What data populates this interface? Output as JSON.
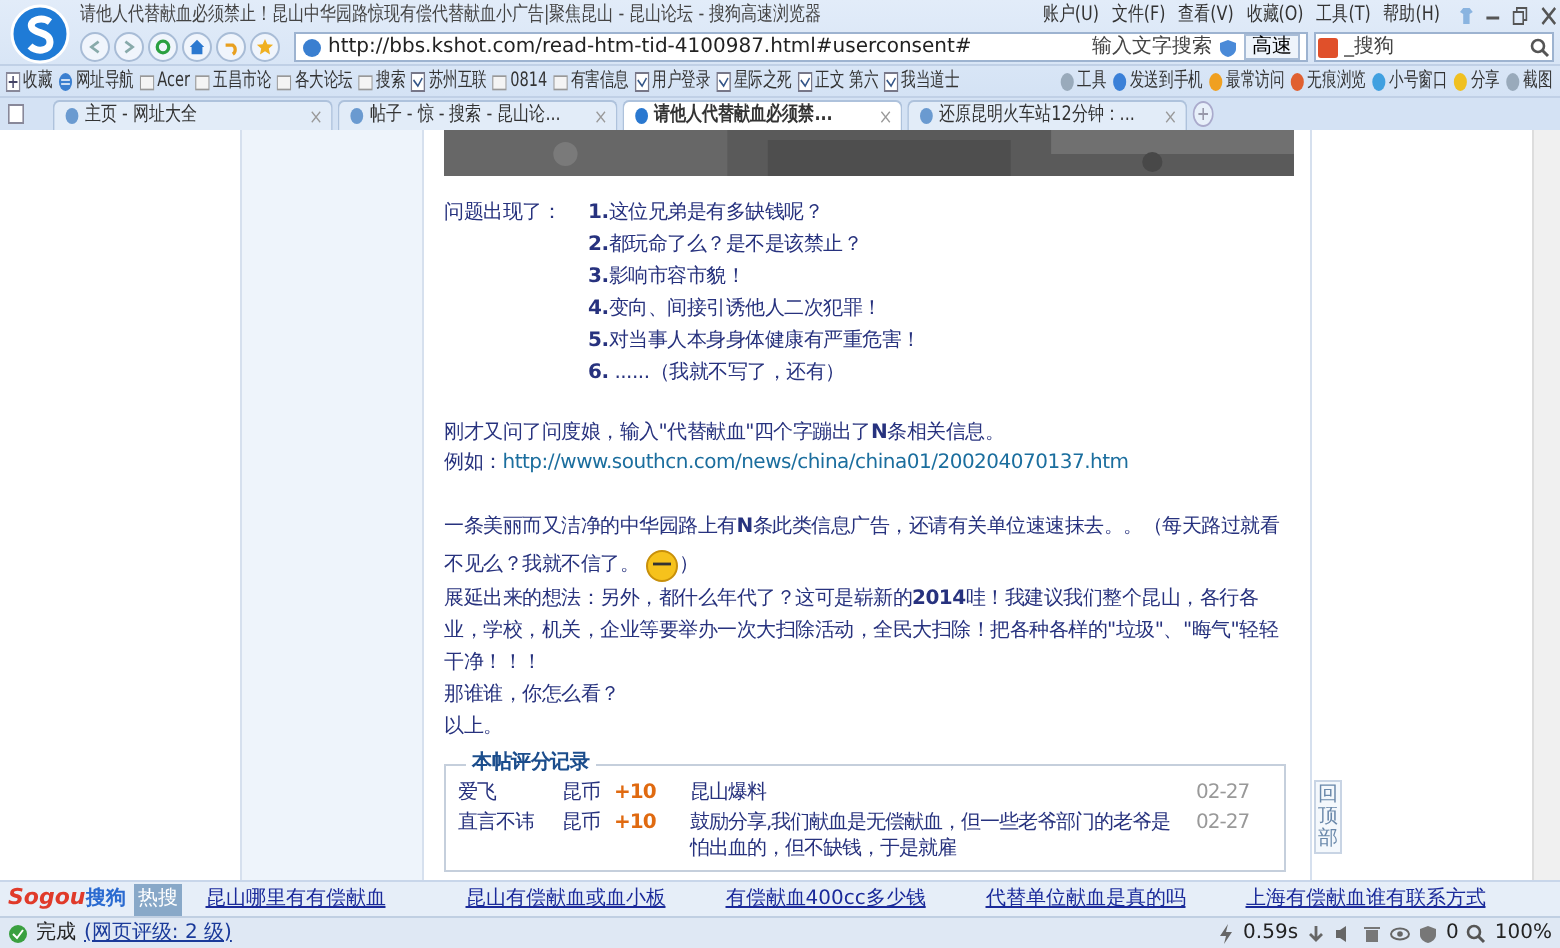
{
  "window": {
    "title": "请他人代替献血必须禁止！昆山中华园路惊现有偿代替献血小广告|聚焦昆山 - 昆山论坛 - 搜狗高速浏览器"
  },
  "menu": [
    "账户(U)",
    "文件(F)",
    "查看(V)",
    "收藏(O)",
    "工具(T)",
    "帮助(H)"
  ],
  "address": {
    "value": "http://bbs.kshot.com/read-htm-tid-4100987.html#userconsent#",
    "search_hint": "输入文字搜索",
    "go": "高速"
  },
  "search": {
    "placeholder": "_搜狗"
  },
  "bookmarks": [
    {
      "label": "收藏",
      "kind": "menu"
    },
    {
      "label": "网址导航",
      "kind": "site"
    },
    {
      "label": "Acer",
      "kind": "folder"
    },
    {
      "label": "五昌市论",
      "kind": "folder"
    },
    {
      "label": "各大论坛",
      "kind": "folder"
    },
    {
      "label": "搜索",
      "kind": "folder"
    },
    {
      "label": "苏州互联",
      "kind": "page"
    },
    {
      "label": "0814",
      "kind": "folder"
    },
    {
      "label": "有害信息",
      "kind": "folder"
    },
    {
      "label": "用户登录",
      "kind": "page"
    },
    {
      "label": "星际之死",
      "kind": "page"
    },
    {
      "label": "正文 第六",
      "kind": "page"
    },
    {
      "label": "我当道士",
      "kind": "page"
    }
  ],
  "tools": [
    {
      "label": "工具",
      "kind": "menu"
    },
    {
      "label": "发送到手机",
      "kind": "phone"
    },
    {
      "label": "最常访问",
      "kind": "frequent"
    },
    {
      "label": "无痕浏览",
      "kind": "private"
    },
    {
      "label": "小号窗口",
      "kind": "window"
    },
    {
      "label": "分享",
      "kind": "share"
    },
    {
      "label": "截图",
      "kind": "menu"
    }
  ],
  "tabs": [
    {
      "label": "主页 - 网址大全",
      "selected": false
    },
    {
      "label": "帖子 - 惊 - 搜索 - 昆山论...",
      "selected": false
    },
    {
      "label": "请他人代替献血必须禁...",
      "selected": true
    },
    {
      "label": "还原昆明火车站12分钟：...",
      "selected": false
    }
  ],
  "post": {
    "problems_label": "问题出现了：",
    "problems": [
      "**1.**这位兄弟是有多缺钱呢？",
      "**2.**都玩命了么？是不是该禁止？",
      "**3.**影响市容市貌！",
      "**4.**变向、间接引诱他人二次犯罪！",
      "**5.**对当事人本身身体健康有严重危害！",
      "**6.** ......（我就不写了，还有）"
    ],
    "search_note": "刚才又问了问度娘，输入\"代替献血\"四个字蹦出了**N**条相关信息。",
    "example_label": "例如：",
    "example_link": "http://www.southcn.com/news/china/china01/200204070137.htm",
    "ad_note": [
      "一条美丽而又洁净的中华园路上有**N**条此类信息广告，还请有关单位速速抹去。。（每天路过就看",
      "不见么？我就不信了。"
    ],
    "ad_note_end": "）",
    "idea": "展延出来的想法：另外，都什么年代了？这可是崭新的**2014**哇！我建议我们整个昆山，各行各业，学校，机关，企业等要举办一次大扫除活动，全民大扫除！把各种各样的\"垃圾\"、\"晦气\"轻轻干净！！！",
    "question": "那谁谁，你怎么看？",
    "closing": "以上。"
  },
  "ratings": {
    "title": "本帖评分记录",
    "rows": [
      {
        "user": "爱飞",
        "currency": "昆币",
        "points": "+10",
        "reason": "昆山爆料",
        "date": "02-27"
      },
      {
        "user": "直言不讳",
        "currency": "昆币",
        "points": "+10",
        "reason": "鼓励分享,我们献血是无偿献血，但一些老爷部门的老爷是怕出血的，但不缺钱，于是就雇",
        "date": "02-27"
      }
    ]
  },
  "back_to_top": "回顶部",
  "hot": {
    "label": "热搜",
    "brand": "Sogou",
    "brand_cn": "搜狗",
    "links": [
      "昆山哪里有有偿献血",
      "昆山有偿献血或血小板",
      "有偿献血400cc多少钱",
      "代替单位献血是真的吗",
      "上海有偿献血谁有联系方式"
    ]
  },
  "status": {
    "text": "完成",
    "rating": "(网页评级: 2 级)",
    "speed": "0.59s",
    "blocked": "0",
    "zoom": "100%"
  }
}
